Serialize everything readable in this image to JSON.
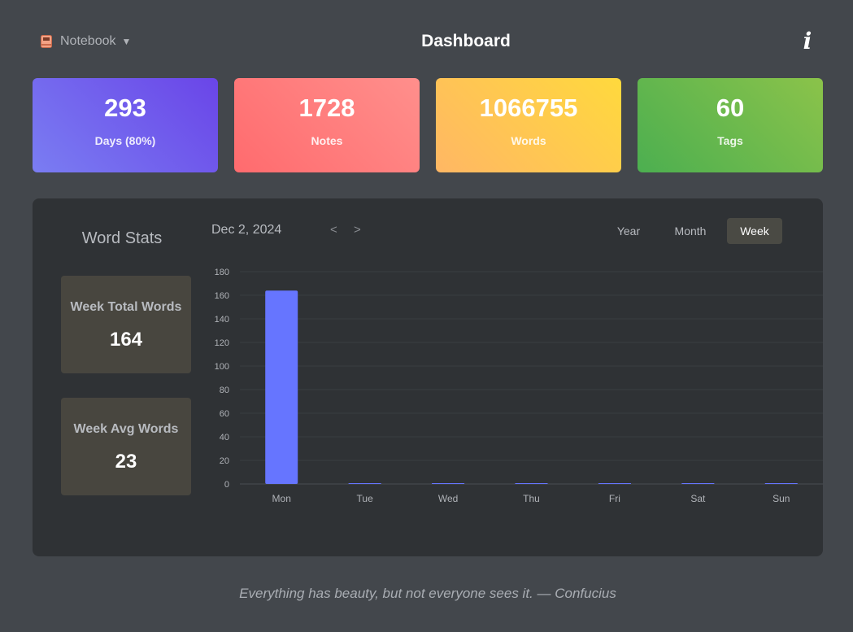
{
  "header": {
    "notebook_label": "Notebook",
    "notebook_caret": "▼",
    "notebook_icon": "notebook-icon",
    "title": "Dashboard",
    "info_label": "i",
    "info_icon": "info-icon"
  },
  "stats": {
    "days": {
      "value": "293",
      "label": "Days (80%)"
    },
    "notes": {
      "value": "1728",
      "label": "Notes"
    },
    "words": {
      "value": "1066755",
      "label": "Words"
    },
    "tags": {
      "value": "60",
      "label": "Tags"
    }
  },
  "word_stats": {
    "title": "Word Stats",
    "week_total": {
      "label": "Week Total Words",
      "value": "164"
    },
    "week_avg": {
      "label": "Week Avg Words",
      "value": "23"
    },
    "date": "Dec 2, 2024",
    "prev_label": "<",
    "next_label": ">",
    "tabs": {
      "year": "Year",
      "month": "Month",
      "week": "Week"
    },
    "active_tab": "Week"
  },
  "colors": {
    "background": "#43474c",
    "panel": "#2f3235",
    "bar": "#6675ff",
    "axis_text": "#b0b3b8",
    "grid": "#3a3d41"
  },
  "chart_data": {
    "type": "bar",
    "categories": [
      "Mon",
      "Tue",
      "Wed",
      "Thu",
      "Fri",
      "Sat",
      "Sun"
    ],
    "values": [
      164,
      0,
      0,
      0,
      0,
      0,
      0
    ],
    "yticks": [
      0,
      20,
      40,
      60,
      80,
      100,
      120,
      140,
      160,
      180
    ],
    "ylim": [
      0,
      180
    ],
    "grid": true,
    "legend": "none"
  },
  "footer": {
    "quote": "Everything has beauty, but not everyone sees it. — Confucius"
  }
}
